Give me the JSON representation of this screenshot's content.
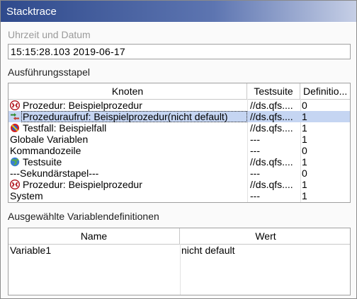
{
  "window": {
    "title": "Stacktrace"
  },
  "datetime": {
    "label": "Uhrzeit und Datum",
    "value": "15:15:28.103  2019-06-17"
  },
  "stack": {
    "label": "Ausführungsstapel",
    "columns": [
      "Knoten",
      "Testsuite",
      "Definitio..."
    ],
    "rows": [
      {
        "icon": "procedure-icon",
        "knoten": "Prozedur: Beispielprozedur",
        "testsuite": "//ds.qfs....",
        "definition": "0"
      },
      {
        "icon": "procedure-call-icon",
        "knoten": "Prozeduraufruf: Beispielprozedur(nicht default)",
        "testsuite": "//ds.qfs....",
        "definition": "1"
      },
      {
        "icon": "testcase-icon",
        "knoten": "Testfall: Beispielfall",
        "testsuite": "//ds.qfs....",
        "definition": "1"
      },
      {
        "icon": "",
        "knoten": "Globale Variablen",
        "testsuite": "---",
        "definition": "1"
      },
      {
        "icon": "",
        "knoten": "Kommandozeile",
        "testsuite": "---",
        "definition": "0"
      },
      {
        "icon": "testsuite-icon",
        "knoten": "Testsuite",
        "testsuite": "//ds.qfs....",
        "definition": "1"
      },
      {
        "icon": "",
        "knoten": "---Sekundärstapel---",
        "testsuite": "---",
        "definition": "0"
      },
      {
        "icon": "procedure-icon",
        "knoten": "Prozedur: Beispielprozedur",
        "testsuite": "//ds.qfs....",
        "definition": "1"
      },
      {
        "icon": "",
        "knoten": "System",
        "testsuite": "---",
        "definition": "1"
      }
    ]
  },
  "variables": {
    "label": "Ausgewählte Variablendefinitionen",
    "columns": [
      "Name",
      "Wert"
    ],
    "rows": [
      {
        "name": "Variable1",
        "wert": "nicht default"
      }
    ]
  }
}
